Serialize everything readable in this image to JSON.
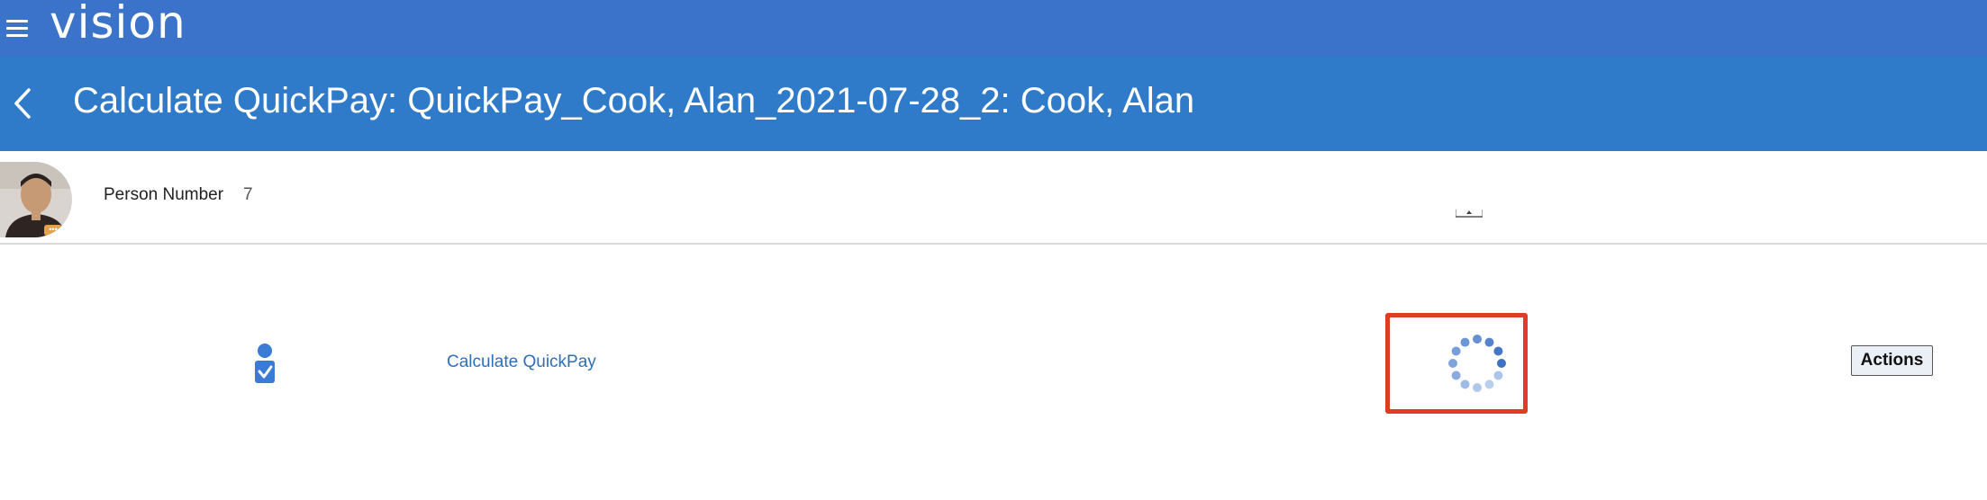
{
  "app": {
    "brand": "vision"
  },
  "header": {
    "title": "Calculate QuickPay: QuickPay_Cook, Alan_2021-07-28_2: Cook, Alan"
  },
  "person": {
    "number_label": "Person Number",
    "number_value": "7"
  },
  "task": {
    "link_label": "Calculate QuickPay",
    "status": "loading"
  },
  "toolbar": {
    "actions_label": "Actions"
  },
  "colors": {
    "brand_bar": "#3a73c9",
    "title_bar": "#2f7bc9",
    "link": "#2f6fb7",
    "highlight_box": "#e03b25"
  },
  "icons": {
    "menu": "hamburger-icon",
    "back": "chevron-left-icon",
    "task": "person-checklist-icon",
    "loading": "spinner-icon"
  }
}
